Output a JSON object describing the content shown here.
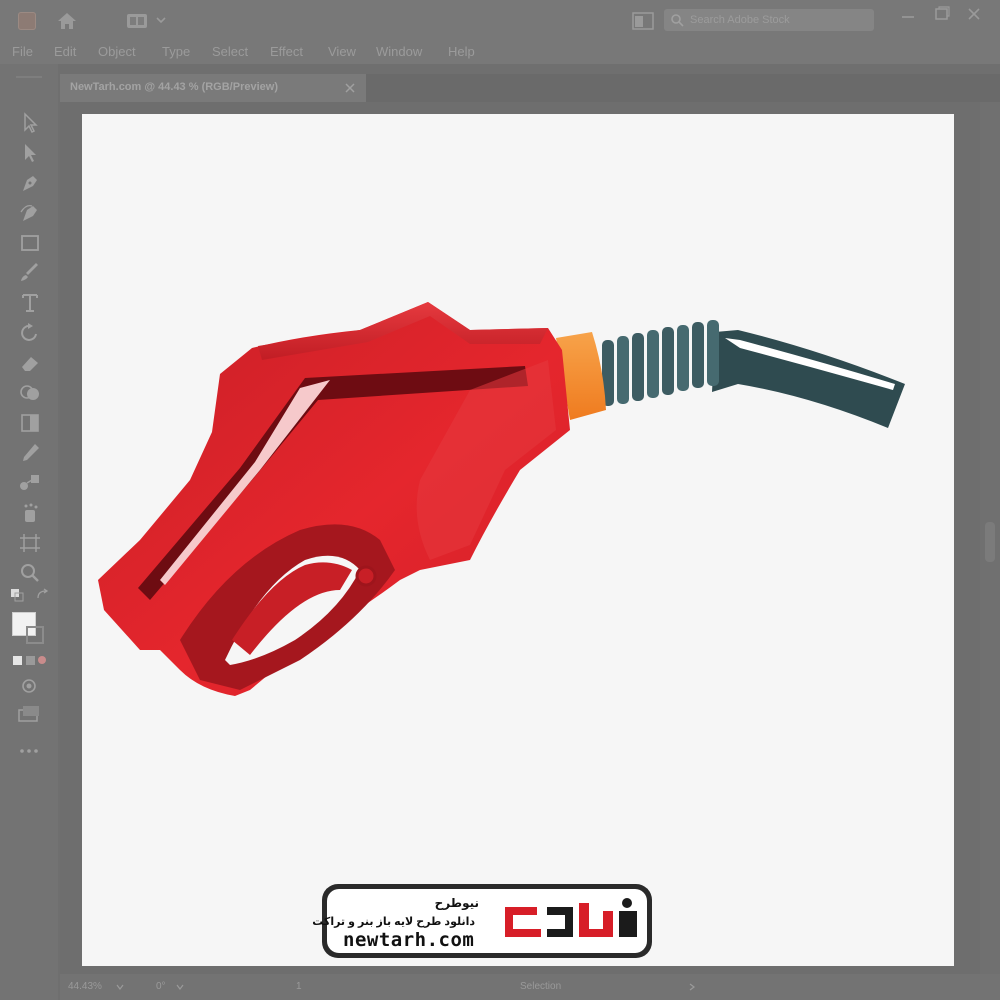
{
  "app": {
    "logo_icon": "illustrator-logo-icon",
    "home_icon": "home-icon",
    "workspace_icon": "workspace-switcher-icon",
    "search_placeholder": "Search Adobe Stock"
  },
  "menu": {
    "items": [
      "File",
      "Edit",
      "Object",
      "Type",
      "Select",
      "Effect",
      "View",
      "Window",
      "Help"
    ]
  },
  "document": {
    "tab_label": "NewTarh.com @ 44.43 % (RGB/Preview)"
  },
  "toolbar": {
    "tools": [
      "selection-tool-icon",
      "direct-selection-tool-icon",
      "pen-tool-icon",
      "curvature-tool-icon",
      "rectangle-tool-icon",
      "paintbrush-tool-icon",
      "type-tool-icon",
      "rotate-tool-icon",
      "eraser-tool-icon",
      "shape-builder-tool-icon",
      "gradient-tool-icon",
      "eyedropper-tool-icon",
      "blend-tool-icon",
      "symbol-sprayer-tool-icon",
      "artboard-tool-icon",
      "zoom-tool-icon"
    ]
  },
  "status": {
    "zoom": "44.43%",
    "rotation": "0°",
    "artboard_index": "1",
    "tool_name": "Selection"
  },
  "watermark": {
    "title": "نیوطرح",
    "subtitle": "دانلود طرح لایه باز بنر و تراکت",
    "logo_text": "نیوطرح",
    "url": "newtarh.com"
  },
  "colors": {
    "nozzle_red": "#d9232c",
    "nozzle_dark_red": "#8e151b",
    "collar_orange": "#f58a28",
    "hose_teal": "#2f4b50",
    "brand_red": "#d71e28"
  }
}
